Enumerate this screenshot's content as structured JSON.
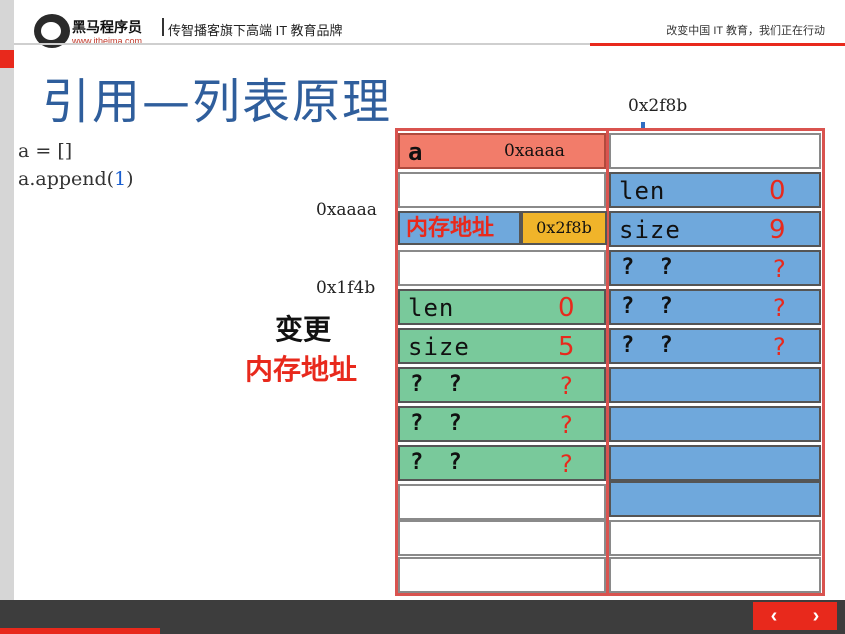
{
  "header": {
    "brand": "黑马程序员",
    "brand_url": "www.itheima.com",
    "tagline": "传智播客旗下高端 IT 教育品牌",
    "slogan": "改变中国 IT 教育，我们正在行动"
  },
  "title": "引用—列表原理",
  "code": {
    "line1": "a = []",
    "line2_prefix": "a.append(",
    "line2_arg": "1",
    "line2_suffix": ")"
  },
  "addresses": {
    "top_block": "0x2f8b",
    "a_addr": "0xaaaa",
    "old_block": "0x1f4b"
  },
  "annotation": {
    "line1": "变更",
    "line2": "内存地址"
  },
  "variable": {
    "name": "a",
    "address": "0xaaaa"
  },
  "pointer": {
    "label": "内存地址",
    "value": "0x2f8b"
  },
  "old_list": {
    "len_label": "len",
    "len_value": "0",
    "size_label": "size",
    "size_value": "5",
    "slot_mark": "? ?",
    "slot_value": "?"
  },
  "new_list": {
    "len_label": "len",
    "len_value": "0",
    "size_label": "size",
    "size_value": "9",
    "slot_mark": "? ?",
    "slot_value": "?"
  },
  "nav": {
    "prev": "‹",
    "next": "›"
  },
  "colors": {
    "title": "#2f5e9c",
    "accent_red": "#e8291c",
    "green_cell": "#79c99b",
    "blue_cell": "#6fa8dc",
    "salmon_cell": "#f27c6a",
    "orange_cell": "#f0b42a"
  }
}
